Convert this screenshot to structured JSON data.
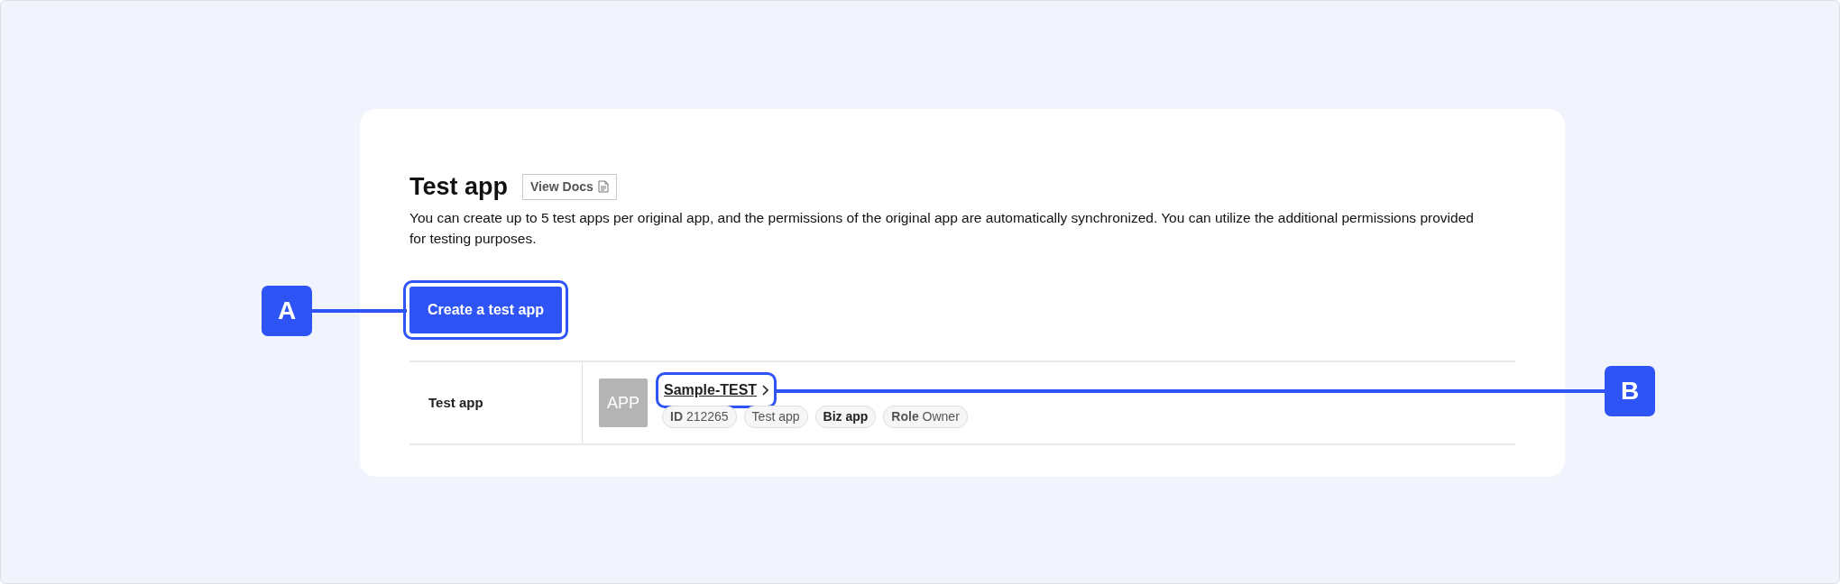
{
  "section": {
    "title": "Test app",
    "docs_button": "View Docs",
    "description": "You can create up to 5 test apps per original app, and the permissions of the original app are automatically synchronized. You can utilize the additional permissions provided for testing purposes.",
    "create_button": {
      "label": "Create a test app",
      "highlighted": true
    }
  },
  "table": {
    "row_label": "Test app",
    "app": {
      "icon_text": "APP",
      "name": "Sample-TEST",
      "highlighted": true,
      "tags": [
        {
          "text": "**ID** 212265",
          "strong": false
        },
        {
          "text": "Test app",
          "strong": false
        },
        {
          "text": "Biz app",
          "strong": true
        },
        {
          "text": "**Role** Owner",
          "strong": false
        }
      ]
    }
  },
  "callouts": [
    {
      "label": "A"
    },
    {
      "label": "B"
    }
  ]
}
